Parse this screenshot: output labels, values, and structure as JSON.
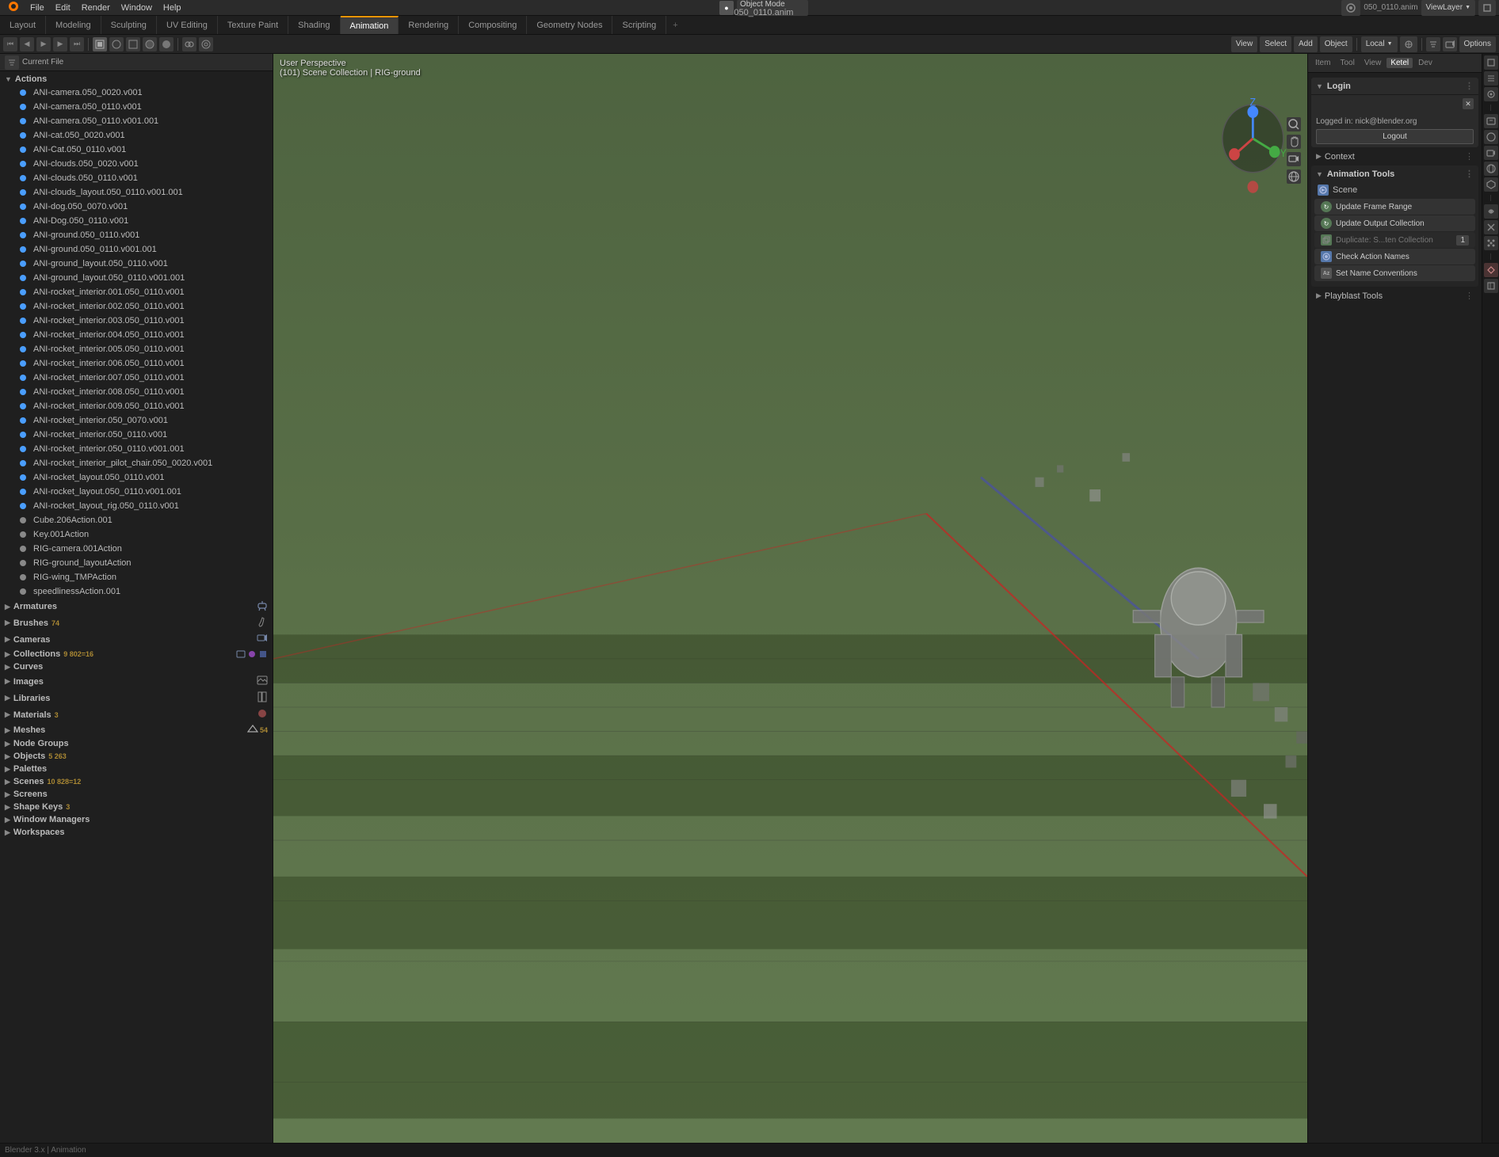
{
  "app": {
    "title": "Blender",
    "filename": "050_0110.anim",
    "viewlayer": "ViewLayer"
  },
  "topMenu": {
    "items": [
      "Blender",
      "File",
      "Edit",
      "Render",
      "Window",
      "Help"
    ]
  },
  "workspaceTabs": {
    "tabs": [
      "Layout",
      "Modeling",
      "Sculpting",
      "UV Editing",
      "Texture Paint",
      "Shading",
      "Animation",
      "Rendering",
      "Compositing",
      "Geometry Nodes",
      "Scripting"
    ],
    "activeTab": "Animation",
    "plusLabel": "+"
  },
  "leftPanel": {
    "currentFile": "Current File",
    "sections": {
      "actions": {
        "label": "Actions",
        "expanded": true,
        "items": [
          "ANI-camera.050_0020.v001",
          "ANI-camera.050_0110.v001",
          "ANI-camera.050_0110.v001.001",
          "ANI-cat.050_0020.v001",
          "ANI-Cat.050_0110.v001",
          "ANI-clouds.050_0020.v001",
          "ANI-clouds.050_0110.v001",
          "ANI-clouds_layout.050_0110.v001.001",
          "ANI-dog.050_0070.v001",
          "ANI-Dog.050_0110.v001",
          "ANI-ground.050_0110.v001",
          "ANI-ground.050_0110.v001.001",
          "ANI-ground_layout.050_0110.v001",
          "ANI-ground_layout.050_0110.v001.001",
          "ANI-rocket_interior.001.050_0110.v001",
          "ANI-rocket_interior.002.050_0110.v001",
          "ANI-rocket_interior.003.050_0110.v001",
          "ANI-rocket_interior.004.050_0110.v001",
          "ANI-rocket_interior.005.050_0110.v001",
          "ANI-rocket_interior.006.050_0110.v001",
          "ANI-rocket_interior.007.050_0110.v001",
          "ANI-rocket_interior.008.050_0110.v001",
          "ANI-rocket_interior.009.050_0110.v001",
          "ANI-rocket_interior.050_0070.v001",
          "ANI-rocket_interior.050_0110.v001",
          "ANI-rocket_interior.050_0110.v001.001",
          "ANI-rocket_interior_pilot_chair.050_0020.v001",
          "ANI-rocket_layout.050_0110.v001",
          "ANI-rocket_layout.050_0110.v001.001",
          "ANI-rocket_layout_rig.050_0110.v001",
          "Cube.206Action.001",
          "Key.001Action",
          "RIG-camera.001Action",
          "RIG-ground_layoutAction",
          "RIG-wing_TMPAction",
          "speedlinessAction.001"
        ]
      },
      "armatures": {
        "label": "Armatures",
        "count": null
      },
      "brushes": {
        "label": "Brushes",
        "count": "74"
      },
      "cameras": {
        "label": "Cameras"
      },
      "collections": {
        "label": "Collections",
        "count": "9 802=16"
      },
      "curves": {
        "label": "Curves"
      },
      "images": {
        "label": "Images"
      },
      "libraries": {
        "label": "Libraries"
      },
      "materials": {
        "label": "Materials",
        "count": "3"
      },
      "meshes": {
        "label": "Meshes",
        "count": "54"
      },
      "nodeGroups": {
        "label": "Node Groups"
      },
      "objects": {
        "label": "Objects",
        "count": "5 263"
      },
      "palettes": {
        "label": "Palettes"
      },
      "scenes": {
        "label": "Scenes",
        "count": "10 828=12"
      },
      "screens": {
        "label": "Screens"
      },
      "shapeKeys": {
        "label": "Shape Keys",
        "count": "3"
      },
      "windowManagers": {
        "label": "Window Managers"
      },
      "workspaces": {
        "label": "Workspaces"
      }
    }
  },
  "viewport": {
    "perspectiveLabel": "User Perspective",
    "collectionLabel": "(101) Scene Collection | RIG-ground",
    "mode": "Object Mode",
    "shading": "Solid",
    "pivot": "Local",
    "overlays": "Options"
  },
  "rightPanel": {
    "login": {
      "header": "Login",
      "loggedInAs": "Logged in: nick@blender.org",
      "logoutLabel": "Logout"
    },
    "context": {
      "header": "Context"
    },
    "animationTools": {
      "header": "Animation Tools",
      "scene": "Scene",
      "buttons": {
        "updateFrameRange": "Update Frame Range",
        "updateOutputCollection": "Update Output Collection",
        "duplicateCollection": "Duplicate: S...ten Collection",
        "checkActionNames": "Check Action Names",
        "setNameConventions": "Set Name Conventions"
      },
      "duplicateNumber": "1"
    },
    "playblastTools": {
      "header": "Playblast Tools"
    }
  },
  "header": {
    "viewMenu": "View",
    "selectMenu": "Select",
    "addMenu": "Add",
    "objectMenu": "Object",
    "localDropdown": "Local",
    "optionsBtn": "Options"
  },
  "icons": {
    "arrow_down": "▼",
    "arrow_right": "▶",
    "refresh": "↻",
    "check": "✓",
    "x": "✕",
    "gear": "⚙",
    "scene": "🎬",
    "camera": "📷",
    "dots": "⋮",
    "plus": "+",
    "minus": "−"
  }
}
